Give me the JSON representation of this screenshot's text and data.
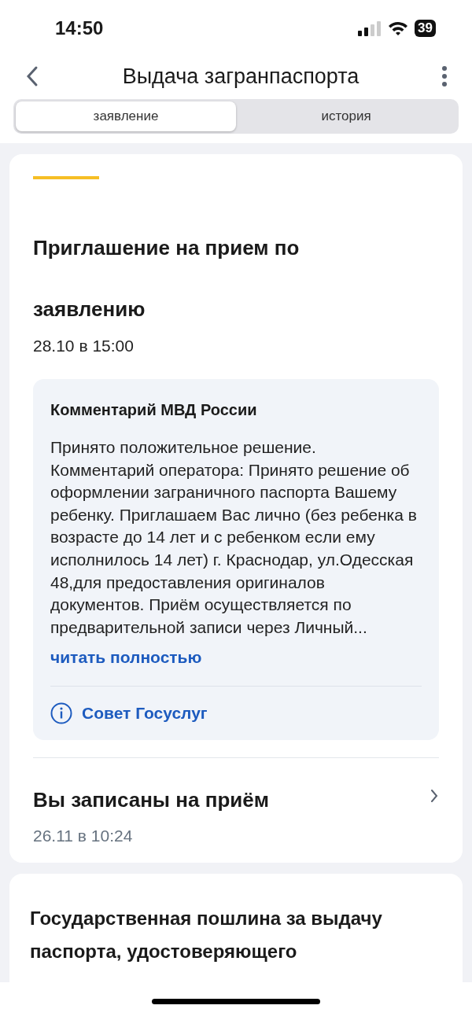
{
  "status_bar": {
    "time": "14:50",
    "battery": "39"
  },
  "header": {
    "title": "Выдача загранпаспорта"
  },
  "tabs": [
    {
      "label": "заявление",
      "selected": true
    },
    {
      "label": "история",
      "selected": false
    }
  ],
  "cards": [
    {
      "title": "Приглашение на прием по заявлению",
      "date": "28.10 в 15:00",
      "comment": {
        "title": "Комментарий МВД России",
        "text": "Принято положительное решение. Комментарий оператора: Принято решение об оформлении заграничного паспорта Вашему ребенку. Приглашаем Вас лично (без ребенка в возрасте до 14 лет и с ребенком если ему  исполнилось 14 лет) г. Краснодар, ул.Одесская 48,для предоставления оригиналов документов. Приём осуществляется по предварительной записи через Личный...",
        "link": "читать полностью",
        "tip": "Совет Госуслуг"
      },
      "event": {
        "title": "Вы записаны на приём",
        "date": "26.11 в 10:24"
      }
    },
    {
      "title": "Государственная пошлина за выдачу паспорта, удостоверяющего"
    }
  ]
}
